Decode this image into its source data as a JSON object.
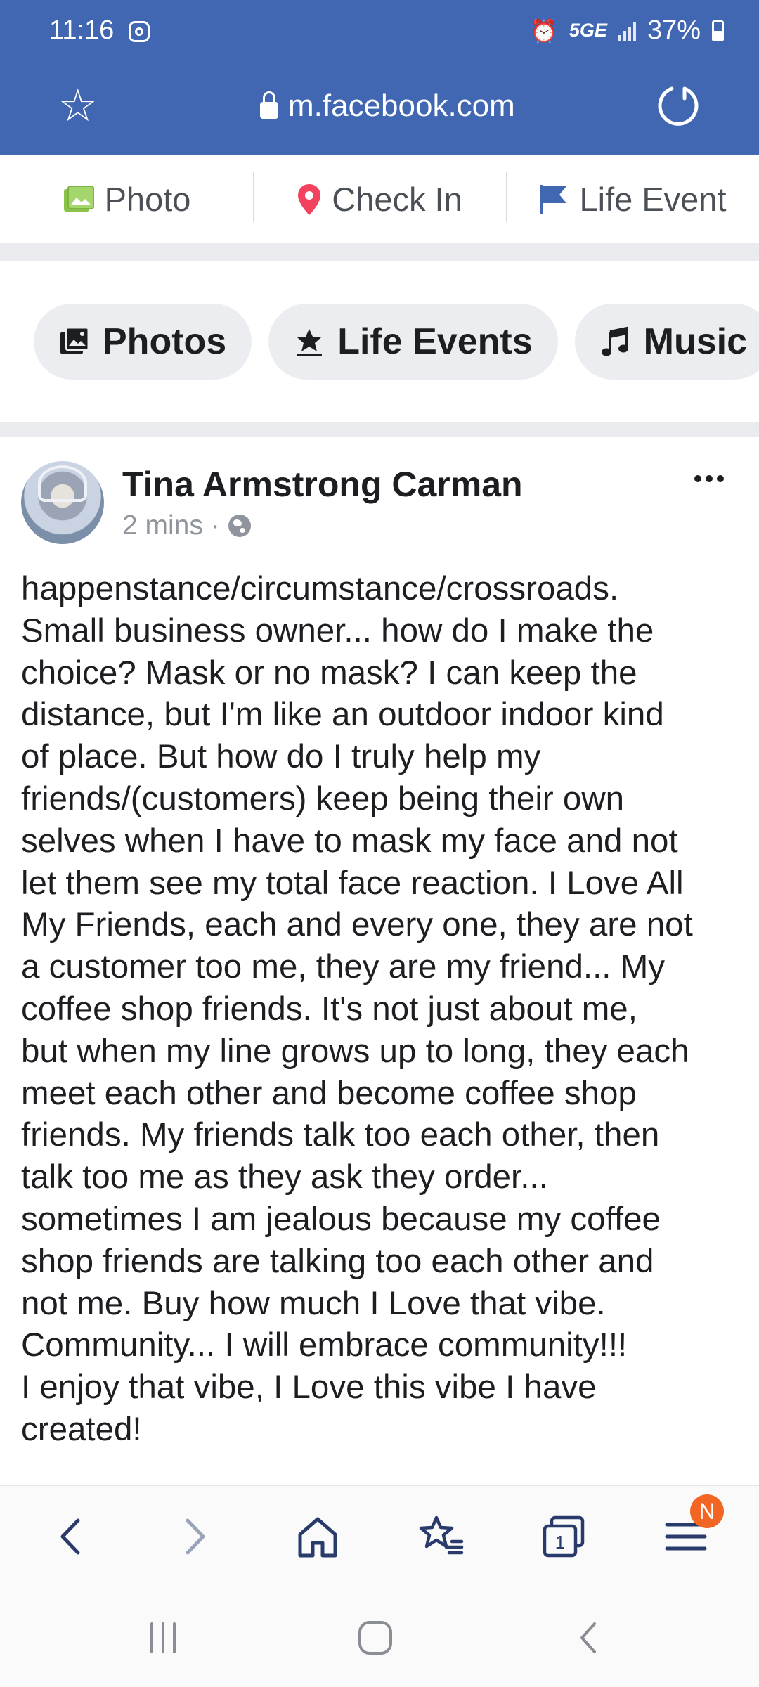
{
  "status_bar": {
    "time": "11:16",
    "network": "5GE",
    "battery": "37%",
    "camera_icon": "camera-icon",
    "alarm_icon": "alarm-icon"
  },
  "browser": {
    "url": "m.facebook.com",
    "bookmark_icon": "star-icon",
    "reload_icon": "reload-icon",
    "accent_color": "#4267b2"
  },
  "composer": {
    "photo_label": "Photo",
    "checkin_label": "Check In",
    "life_event_label": "Life Event"
  },
  "chips": [
    {
      "label": "Photos",
      "icon": "photos-icon"
    },
    {
      "label": "Life Events",
      "icon": "life-events-icon"
    },
    {
      "label": "Music",
      "icon": "music-icon"
    }
  ],
  "post": {
    "author": "Tina Armstrong Carman",
    "time": "2 mins ·",
    "privacy_icon": "globe-icon",
    "body": "happenstance/circumstance/crossroads.\nSmall business owner... how do I make the\nchoice? Mask or no mask? I can keep the\ndistance, but I'm like an outdoor indoor kind\nof place. But how do I truly help my\nfriends/(customers) keep being their own\nselves when I have to mask my face and not\nlet them see my total face reaction. I Love All\nMy Friends, each and every one, they are not\na customer too me, they are my friend... My\ncoffee shop friends. It's not just about me,\nbut when my line grows up to long, they each\nmeet each other and become coffee shop\nfriends. My friends talk too each other, then\ntalk too me as they ask they order...\nsometimes I am jealous because my coffee\nshop friends are talking too each other and\nnot me. Buy how much I Love that vibe.\nCommunity... I will embrace community!!!\nI enjoy that vibe, I Love this vibe I have\ncreated!"
  },
  "toolbar": {
    "tabs_count": "1",
    "menu_badge": "N",
    "icons": [
      "back-icon",
      "forward-icon",
      "home-icon",
      "bookmarks-icon",
      "tabs-icon",
      "menu-icon"
    ]
  },
  "nav_bar": {
    "icons": [
      "recents-icon",
      "home-nav-icon",
      "back-nav-icon"
    ]
  }
}
